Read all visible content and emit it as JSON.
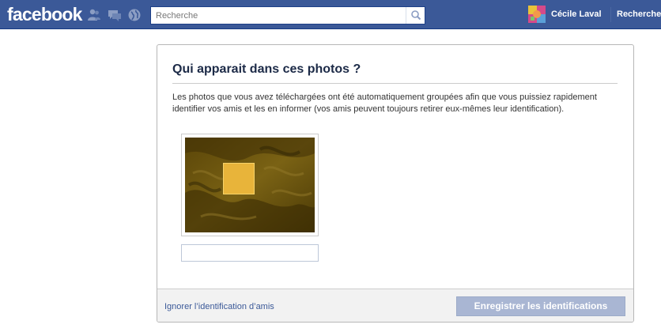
{
  "header": {
    "logo_text": "facebook",
    "search_placeholder": "Recherche",
    "user_name": "Cécile Laval",
    "nav_link": "Recherche",
    "colors": {
      "bar": "#3b5998",
      "bar_border": "#133783"
    },
    "icons": [
      "friend-requests-icon",
      "messages-icon",
      "notifications-globe-icon",
      "magnifier-icon"
    ]
  },
  "dialog": {
    "title": "Qui apparait dans ces photos ?",
    "description": "Les photos que vous avez téléchargées ont été automatiquement groupées afin que vous puissiez rapidement identifier vos amis et les en informer (vos amis peuvent toujours retirer eux-mêmes leur identification).",
    "tag_input_value": "",
    "skip_link": "Ignorer l’identification d’amis",
    "save_button": "Enregistrer les identifications"
  },
  "colors": {
    "link": "#3b5998",
    "title": "#1c2a47",
    "disabled_button": "#a9b6d3",
    "face_box": "#e8b43a"
  }
}
